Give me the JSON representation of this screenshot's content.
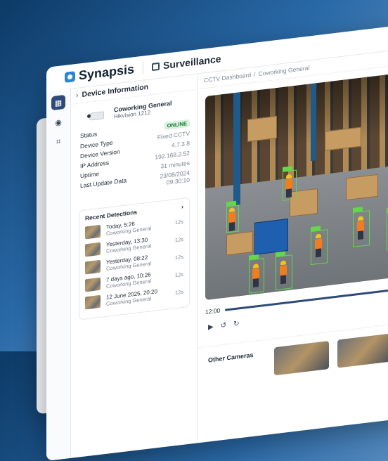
{
  "app": {
    "name": "Synapsis",
    "module": "Surveillance"
  },
  "sidebar": {
    "items": [
      {
        "icon": "dashboard-icon",
        "active": true
      },
      {
        "icon": "camera-icon",
        "active": false
      },
      {
        "icon": "scan-face-icon",
        "active": false
      }
    ]
  },
  "device": {
    "panel_title": "Device Information",
    "name": "Coworking General",
    "model": "Hikvision 1212",
    "fields": [
      {
        "label": "Status",
        "value": "ONLINE"
      },
      {
        "label": "Device Type",
        "value": "Fixed CCTV"
      },
      {
        "label": "Device Version",
        "value": "4.7.3.8"
      },
      {
        "label": "IP Address",
        "value": "192.168.2.52"
      },
      {
        "label": "Uptime",
        "value": "31 minutes"
      },
      {
        "label": "Last Update Data",
        "value": "23/08/2024",
        "value2": "09:30:10"
      }
    ]
  },
  "detections": {
    "title": "Recent Detections",
    "items": [
      {
        "time": "Today, 5:26",
        "location": "Coworking General",
        "duration": "12s"
      },
      {
        "time": "Yesterday, 13:30",
        "location": "Coworking General",
        "duration": "12s"
      },
      {
        "time": "Yesterday, 08:22",
        "location": "Coworking General",
        "duration": "12s"
      },
      {
        "time": "7 days ago, 10:26",
        "location": "Coworking General",
        "duration": "12s"
      },
      {
        "time": "12 June 2025, 20:20",
        "location": "Coworking General",
        "duration": "12s"
      }
    ]
  },
  "breadcrumb": [
    "CCTV Dashboard",
    "Coworking General"
  ],
  "player": {
    "time": "12:00",
    "progress": 0.88
  },
  "other_cameras": {
    "title": "Other Cameras"
  },
  "colors": {
    "accent": "#2e4a7a",
    "brand": "#2a86d8",
    "online_bg": "#d8f3dc",
    "online_fg": "#1c7a3a",
    "bbox": "#63d84b"
  }
}
